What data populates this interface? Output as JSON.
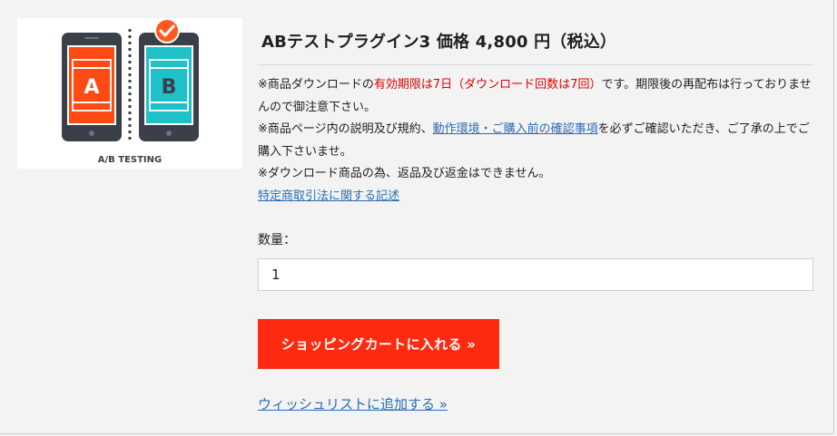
{
  "product": {
    "title": "ABテストプラグイン3 価格 4,800 円（税込）",
    "image": {
      "caption": "A/B TESTING",
      "variant_a_letter": "A",
      "variant_b_letter": "B",
      "colors": {
        "phone_body": "#3a3f4a",
        "variant_a": "#ff4a14",
        "variant_b": "#1fc0c7",
        "check_badge": "#ff5a1f"
      }
    }
  },
  "notice": {
    "line1_pre": "※商品ダウンロードの",
    "line1_red": "有効期限は7日（ダウンロード回数は7回）",
    "line1_post": "です。期限後の再配布は行っておりませんので御注意下さい。",
    "line2_pre": "※商品ページ内の説明及び規約、",
    "line2_link": "動作環境・ご購入前の確認事項",
    "line2_post": "を必ずご確認いただき、ご了承の上でご購入下さいませ。",
    "line3": "※ダウンロード商品の為、返品及び返金はできません。",
    "legal_link": "特定商取引法に関する記述"
  },
  "quantity": {
    "label": "数量：",
    "value": "1"
  },
  "actions": {
    "add_to_cart": "ショッピングカートに入れる »",
    "wishlist": "ウィッシュリストに追加する »"
  },
  "colors": {
    "accent_red": "#ff2a0f",
    "link_blue": "#2a6db8",
    "notice_red": "#e00000"
  }
}
